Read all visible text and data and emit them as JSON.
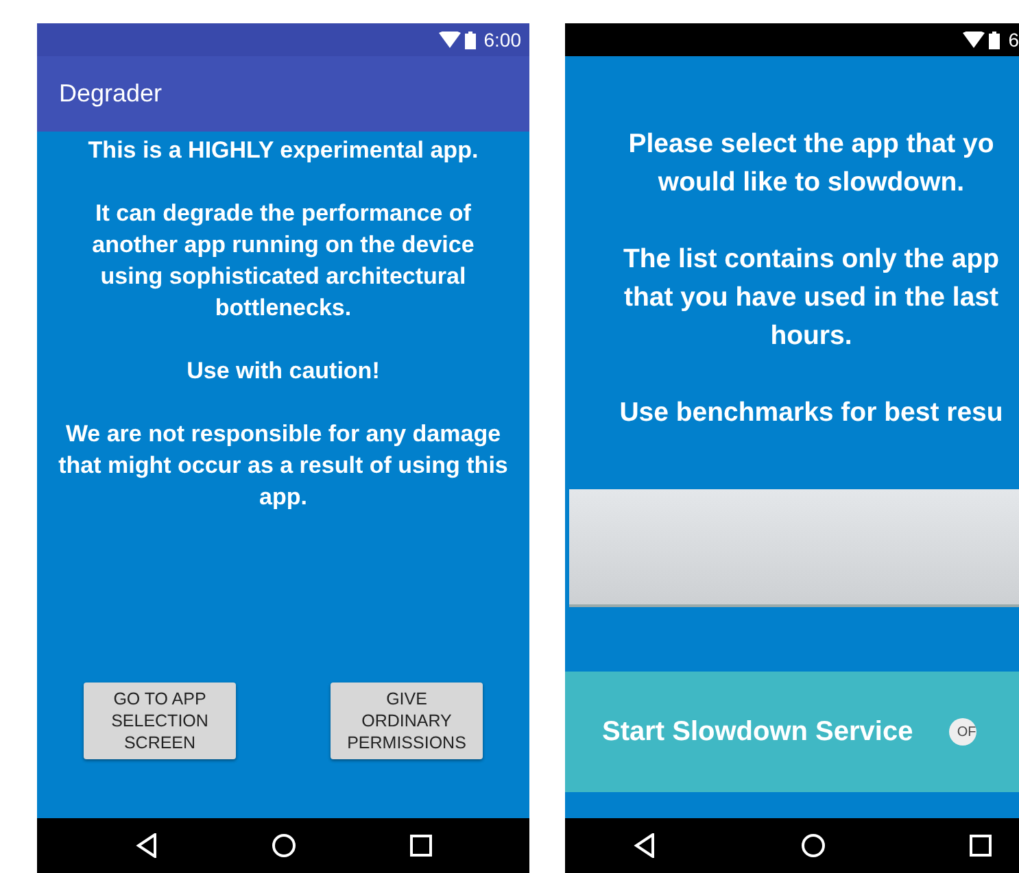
{
  "left_phone": {
    "status_bar": {
      "time": "6:00"
    },
    "toolbar": {
      "title": "Degrader"
    },
    "paragraphs": [
      "This is a HIGHLY experimental app.",
      "It can degrade the performance of another app running on the device using sophisticated architectural bottlenecks.",
      "Use with caution!",
      "We are not responsible for any damage that might occur as a result of using this app."
    ],
    "buttons": [
      "GO TO APP SELECTION SCREEN",
      "GIVE ORDINARY PERMISSIONS"
    ]
  },
  "right_phone": {
    "status_bar": {
      "time": "6"
    },
    "paragraphs": [
      [
        "Please select the app that yo",
        "would like to slowdown."
      ],
      [
        "The list contains only the app",
        "that you have used in the last",
        "hours."
      ],
      [
        "Use benchmarks for best resu"
      ]
    ],
    "service": {
      "label": "Start Slowdown Service",
      "switch": {
        "label": "OF",
        "on": false
      }
    }
  }
}
